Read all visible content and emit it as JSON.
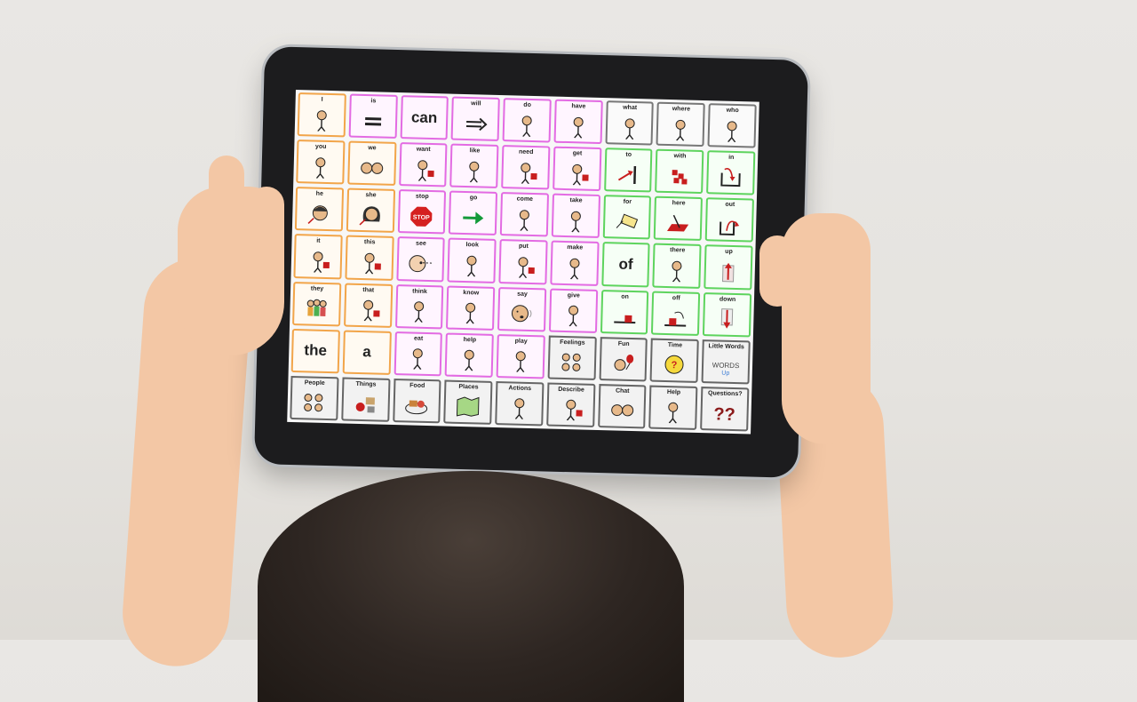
{
  "cells": [
    {
      "label": "I",
      "kind": "pronoun",
      "icon": "person-pointing-self"
    },
    {
      "label": "is",
      "kind": "verb",
      "icon": "equals"
    },
    {
      "label": "can",
      "kind": "verb",
      "big": true,
      "icon": "text-word"
    },
    {
      "label": "will",
      "kind": "verb",
      "icon": "arrow-right"
    },
    {
      "label": "do",
      "kind": "verb",
      "icon": "person-doing"
    },
    {
      "label": "have",
      "kind": "verb",
      "icon": "person-holding"
    },
    {
      "label": "what",
      "kind": "question",
      "icon": "person-question"
    },
    {
      "label": "where",
      "kind": "question",
      "icon": "person-question"
    },
    {
      "label": "who",
      "kind": "question",
      "icon": "person-question"
    },
    {
      "label": "you",
      "kind": "pronoun",
      "icon": "two-people"
    },
    {
      "label": "we",
      "kind": "pronoun",
      "icon": "two-faces"
    },
    {
      "label": "want",
      "kind": "verb",
      "icon": "person-wanting"
    },
    {
      "label": "like",
      "kind": "verb",
      "icon": "person-liking"
    },
    {
      "label": "need",
      "kind": "verb",
      "icon": "person-needing"
    },
    {
      "label": "get",
      "kind": "verb",
      "icon": "person-getting"
    },
    {
      "label": "to",
      "kind": "prep",
      "icon": "arrow-to-line"
    },
    {
      "label": "with",
      "kind": "prep",
      "icon": "blocks-together"
    },
    {
      "label": "in",
      "kind": "prep",
      "icon": "arrow-into-box"
    },
    {
      "label": "he",
      "kind": "pronoun",
      "icon": "boy-face"
    },
    {
      "label": "she",
      "kind": "pronoun",
      "icon": "girl-face"
    },
    {
      "label": "stop",
      "kind": "verb",
      "icon": "stop-sign"
    },
    {
      "label": "go",
      "kind": "verb",
      "icon": "green-arrow"
    },
    {
      "label": "come",
      "kind": "verb",
      "icon": "person-coming"
    },
    {
      "label": "take",
      "kind": "verb",
      "icon": "person-taking"
    },
    {
      "label": "for",
      "kind": "prep",
      "icon": "gift-tag"
    },
    {
      "label": "here",
      "kind": "prep",
      "icon": "point-here"
    },
    {
      "label": "out",
      "kind": "prep",
      "icon": "arrow-out-of-box"
    },
    {
      "label": "it",
      "kind": "pronoun",
      "icon": "point-at-block"
    },
    {
      "label": "this",
      "kind": "pronoun",
      "icon": "person-pointing-block"
    },
    {
      "label": "see",
      "kind": "verb",
      "icon": "eye-face"
    },
    {
      "label": "look",
      "kind": "verb",
      "icon": "person-looking"
    },
    {
      "label": "put",
      "kind": "verb",
      "icon": "person-putting"
    },
    {
      "label": "make",
      "kind": "verb",
      "icon": "person-making"
    },
    {
      "label": "of",
      "kind": "prep",
      "big": true,
      "icon": "text-word"
    },
    {
      "label": "there",
      "kind": "prep",
      "icon": "person-pointing-there"
    },
    {
      "label": "up",
      "kind": "prep",
      "icon": "arrow-up"
    },
    {
      "label": "they",
      "kind": "pronoun",
      "icon": "group-people"
    },
    {
      "label": "that",
      "kind": "pronoun",
      "icon": "point-at-far-block"
    },
    {
      "label": "think",
      "kind": "verb",
      "icon": "person-thinking"
    },
    {
      "label": "know",
      "kind": "verb",
      "icon": "person-knowing"
    },
    {
      "label": "say",
      "kind": "verb",
      "icon": "face-speaking"
    },
    {
      "label": "give",
      "kind": "verb",
      "icon": "people-giving"
    },
    {
      "label": "on",
      "kind": "prep",
      "icon": "block-on-surface"
    },
    {
      "label": "off",
      "kind": "prep",
      "icon": "block-off-surface"
    },
    {
      "label": "down",
      "kind": "prep",
      "icon": "arrow-down"
    },
    {
      "label": "the",
      "kind": "pronoun",
      "big": true,
      "icon": "text-word"
    },
    {
      "label": "a",
      "kind": "pronoun",
      "big": true,
      "icon": "text-word"
    },
    {
      "label": "eat",
      "kind": "verb",
      "icon": "person-eating"
    },
    {
      "label": "help",
      "kind": "verb",
      "icon": "people-helping"
    },
    {
      "label": "play",
      "kind": "verb",
      "icon": "people-playing"
    },
    {
      "label": "Feelings",
      "kind": "folder",
      "icon": "faces-grid"
    },
    {
      "label": "Fun",
      "kind": "folder",
      "icon": "face-balloon"
    },
    {
      "label": "Time",
      "kind": "folder",
      "icon": "clock-question"
    },
    {
      "label": "Little Words",
      "kind": "folder",
      "icon": "words-up",
      "sub": "WORDS",
      "sub2": "Up"
    },
    {
      "label": "People",
      "kind": "folder",
      "icon": "group-faces"
    },
    {
      "label": "Things",
      "kind": "folder",
      "icon": "objects"
    },
    {
      "label": "Food",
      "kind": "folder",
      "icon": "food-plate"
    },
    {
      "label": "Places",
      "kind": "folder",
      "icon": "map"
    },
    {
      "label": "Actions",
      "kind": "folder",
      "icon": "person-biking"
    },
    {
      "label": "Describe",
      "kind": "folder",
      "icon": "describe-items"
    },
    {
      "label": "Chat",
      "kind": "folder",
      "icon": "two-faces-chat"
    },
    {
      "label": "Help",
      "kind": "folder",
      "icon": "people-helping"
    },
    {
      "label": "Questions?",
      "kind": "folder",
      "icon": "question-marks",
      "sub": "??"
    }
  ],
  "colors": {
    "pronoun": "#f2a54a",
    "verb": "#e36be3",
    "prep": "#5ed45e",
    "folder": "#666666"
  }
}
